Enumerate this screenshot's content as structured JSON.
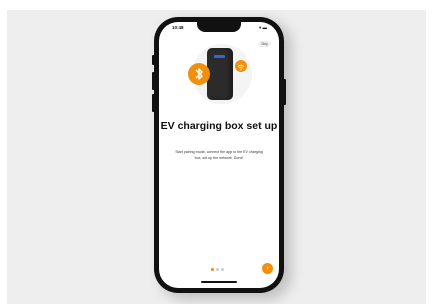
{
  "status_bar": {
    "time": "10:48",
    "icons": "▾ ▬"
  },
  "header": {
    "skip_label": "Skip"
  },
  "hero": {
    "bluetooth_icon": "bluetooth-icon",
    "wifi_icon": "wifi-icon",
    "device": "ev-charger"
  },
  "content": {
    "title": "EV charging box set up",
    "description": "Start pairing mode, connect the app to the EV charging box, set up the network. Done!"
  },
  "pagination": {
    "total": 3,
    "active_index": 0
  },
  "footer": {
    "next_icon": "›"
  },
  "colors": {
    "accent": "#f0900c",
    "charger_body": "#2b2b2b",
    "charger_light": "#3a64d0",
    "background": "#eeeeee"
  }
}
